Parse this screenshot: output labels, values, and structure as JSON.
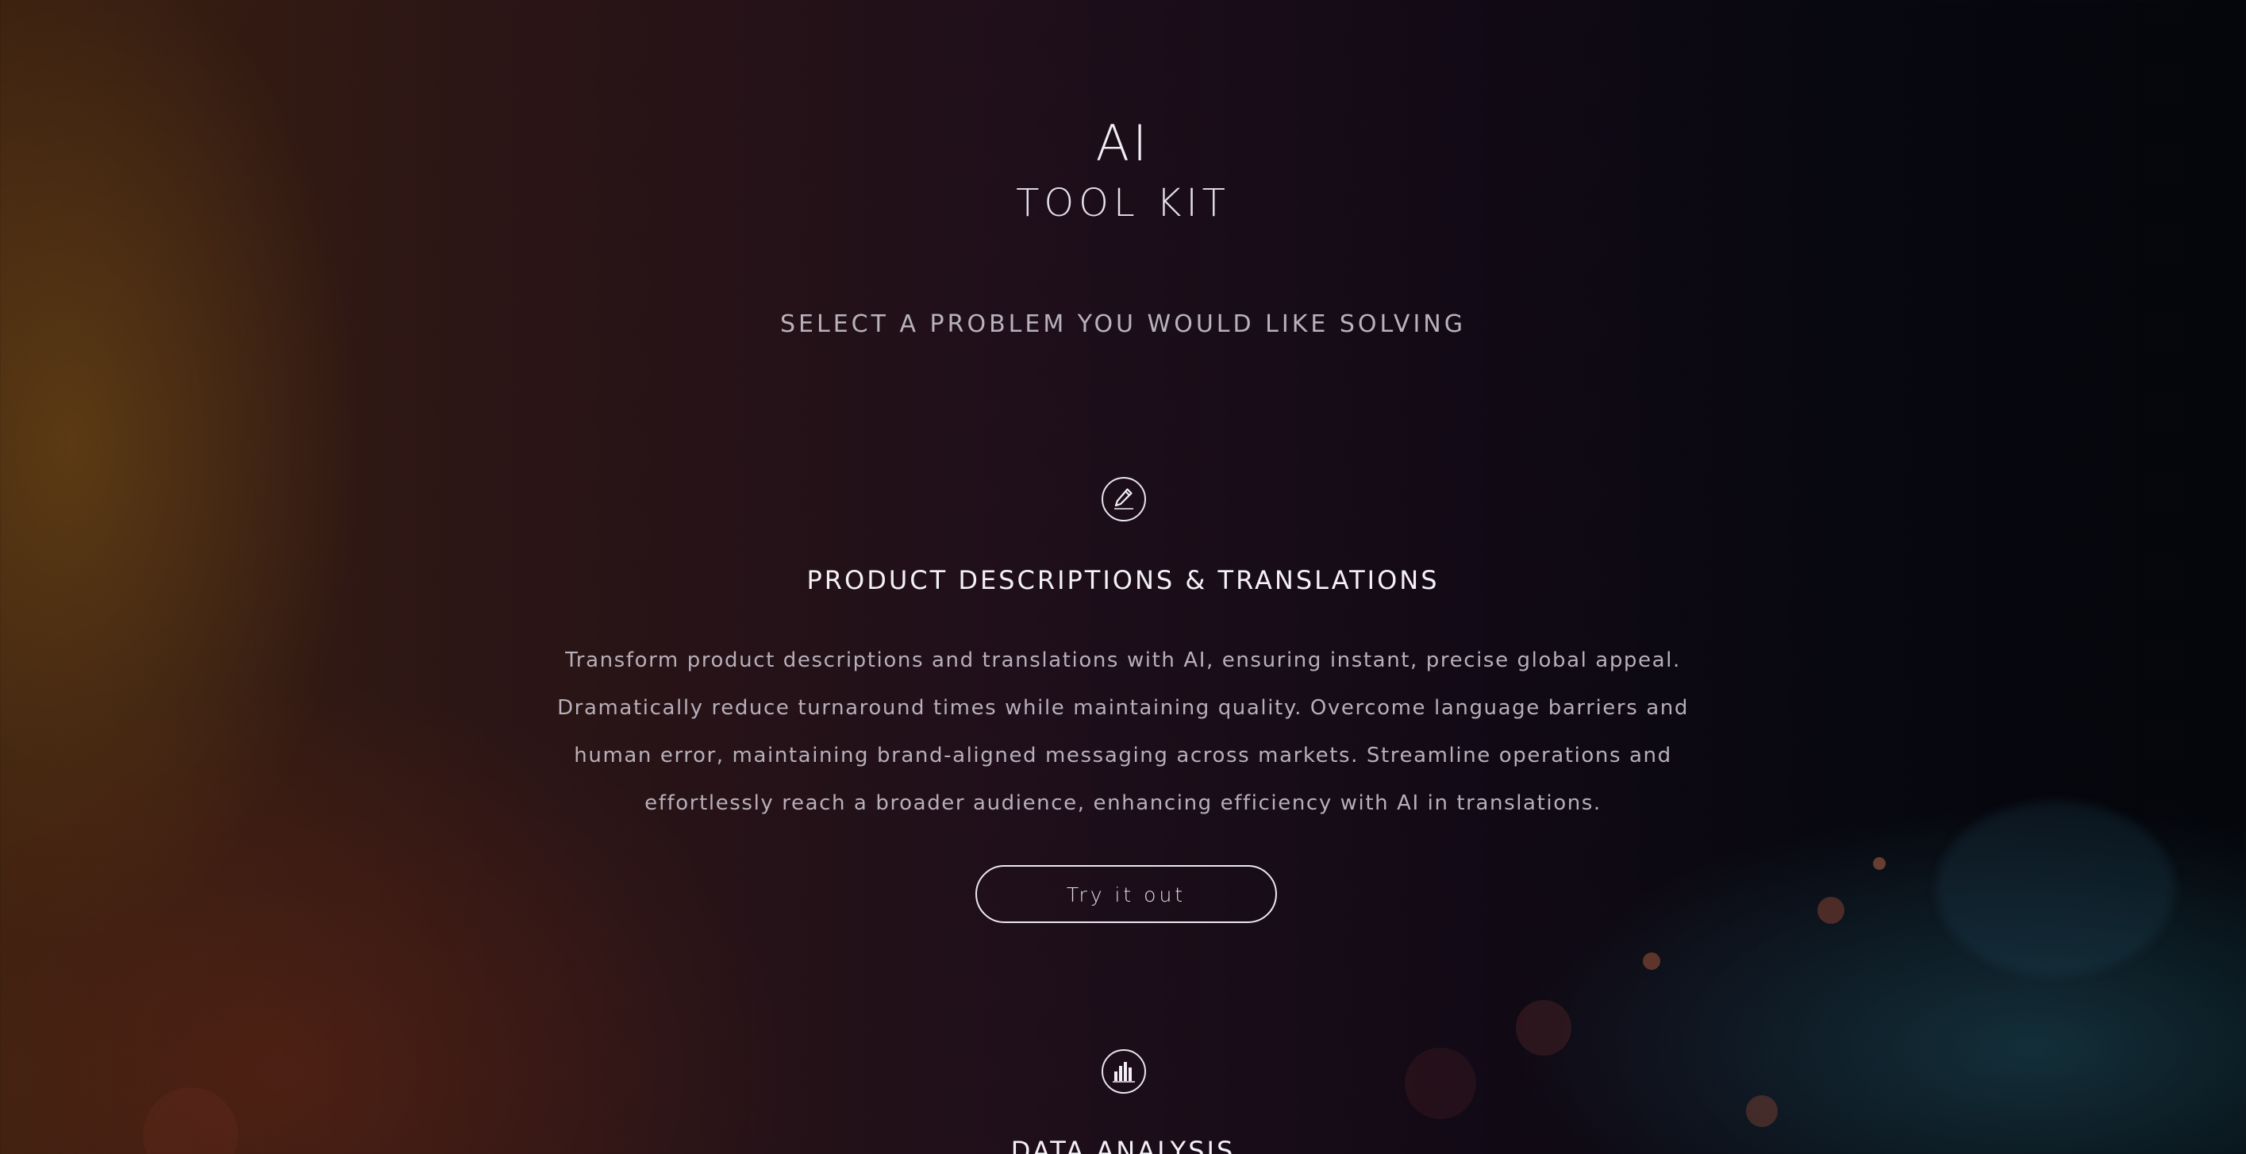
{
  "header": {
    "title": "AI",
    "subtitle": "TOOL KIT",
    "prompt": "SELECT A PROBLEM YOU WOULD LIKE SOLVING"
  },
  "tools": [
    {
      "icon": "pencil-icon",
      "title": "PRODUCT DESCRIPTIONS & TRANSLATIONS",
      "description": "Transform product descriptions and translations with AI, ensuring instant, precise global appeal. Dramatically reduce turnaround times while maintaining quality. Overcome language barriers and human error, maintaining brand-aligned messaging across markets. Streamline operations and effortlessly reach a broader audience, enhancing efficiency with AI in translations.",
      "button_label": "Try it out"
    },
    {
      "icon": "bar-chart-icon",
      "title": "DATA ANALYSIS"
    }
  ],
  "colors": {
    "text": "#f4f1f6",
    "muted_text": "#b7afb9",
    "background_dark": "#04060b",
    "background_warm": "#3a2010"
  }
}
